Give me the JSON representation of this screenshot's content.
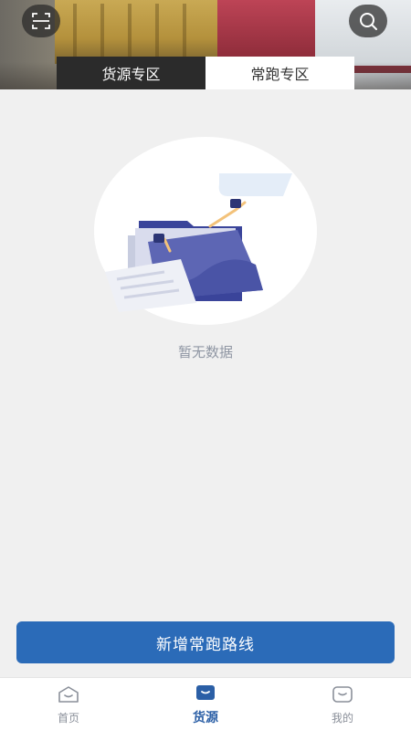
{
  "header": {
    "scan_icon": "scan-icon",
    "search_icon": "search-icon",
    "tabs": [
      {
        "label": "货源专区"
      },
      {
        "label": "常跑专区"
      }
    ]
  },
  "empty_state": {
    "message": "暂无数据",
    "illustration": "empty-folder-illustration"
  },
  "actions": {
    "add_route_label": "新增常跑路线"
  },
  "bottom_nav": {
    "items": [
      {
        "label": "首页",
        "icon": "home-icon",
        "active": false
      },
      {
        "label": "货源",
        "icon": "cargo-icon",
        "active": true
      },
      {
        "label": "我的",
        "icon": "profile-icon",
        "active": false
      }
    ]
  },
  "colors": {
    "primary": "#2b6bb8",
    "nav_active": "#2b5fa6",
    "background": "#f0f0f0"
  }
}
